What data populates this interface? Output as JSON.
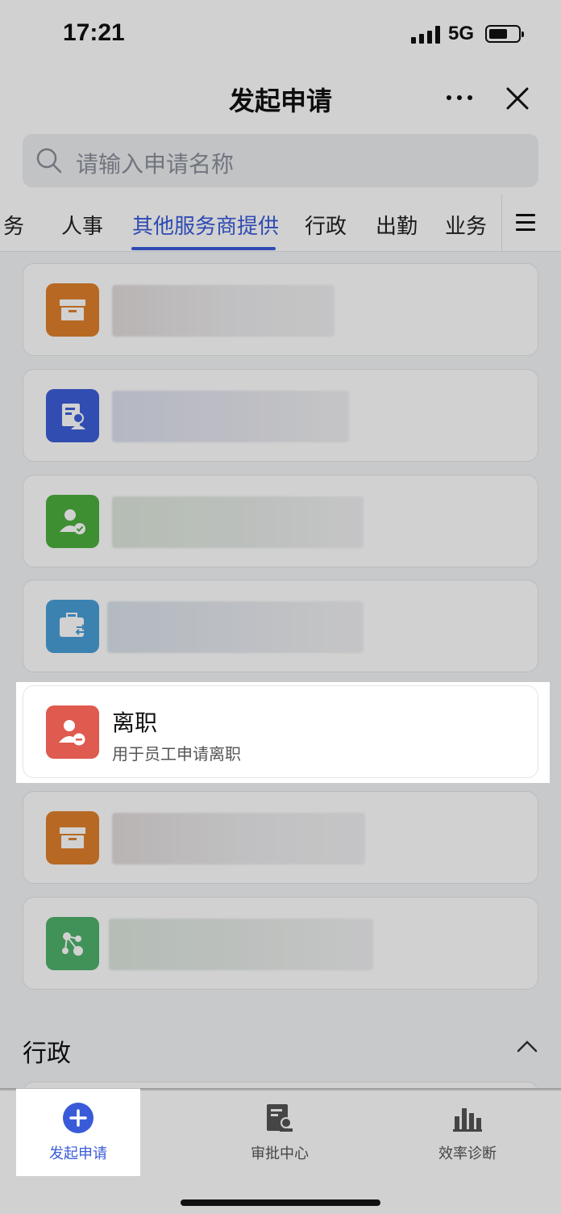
{
  "status_bar": {
    "time": "17:21",
    "network": "5G"
  },
  "nav": {
    "title": "发起申请"
  },
  "search": {
    "placeholder": "请输入申请名称"
  },
  "tabs": [
    {
      "label": "务",
      "active": false
    },
    {
      "label": "人事",
      "active": false
    },
    {
      "label": "其他服务商提供",
      "active": true
    },
    {
      "label": "行政",
      "active": false
    },
    {
      "label": "出勤",
      "active": false
    },
    {
      "label": "业务",
      "active": false
    }
  ],
  "cards": [
    {
      "icon": "box-icon",
      "color": "#e0802c"
    },
    {
      "icon": "document-person-icon",
      "color": "#3c5ed8"
    },
    {
      "icon": "person-check-icon",
      "color": "#4caf3e"
    },
    {
      "icon": "briefcase-transfer-icon",
      "color": "#4a9fd8"
    },
    {
      "icon": "person-minus-icon",
      "color": "#df5a4f",
      "title": "离职",
      "subtitle": "用于员工申请离职"
    },
    {
      "icon": "box-icon",
      "color": "#e0802c"
    },
    {
      "icon": "share-nodes-icon",
      "color": "#4fb36c"
    }
  ],
  "section": {
    "title": "行政"
  },
  "bottom_tabs": [
    {
      "label": "发起申请",
      "icon": "plus-circle-icon",
      "active": true
    },
    {
      "label": "审批中心",
      "icon": "approval-icon",
      "active": false
    },
    {
      "label": "效率诊断",
      "icon": "bar-chart-icon",
      "active": false
    }
  ],
  "colors": {
    "accent": "#3a5bd9",
    "leave_icon": "#df5a4f"
  }
}
